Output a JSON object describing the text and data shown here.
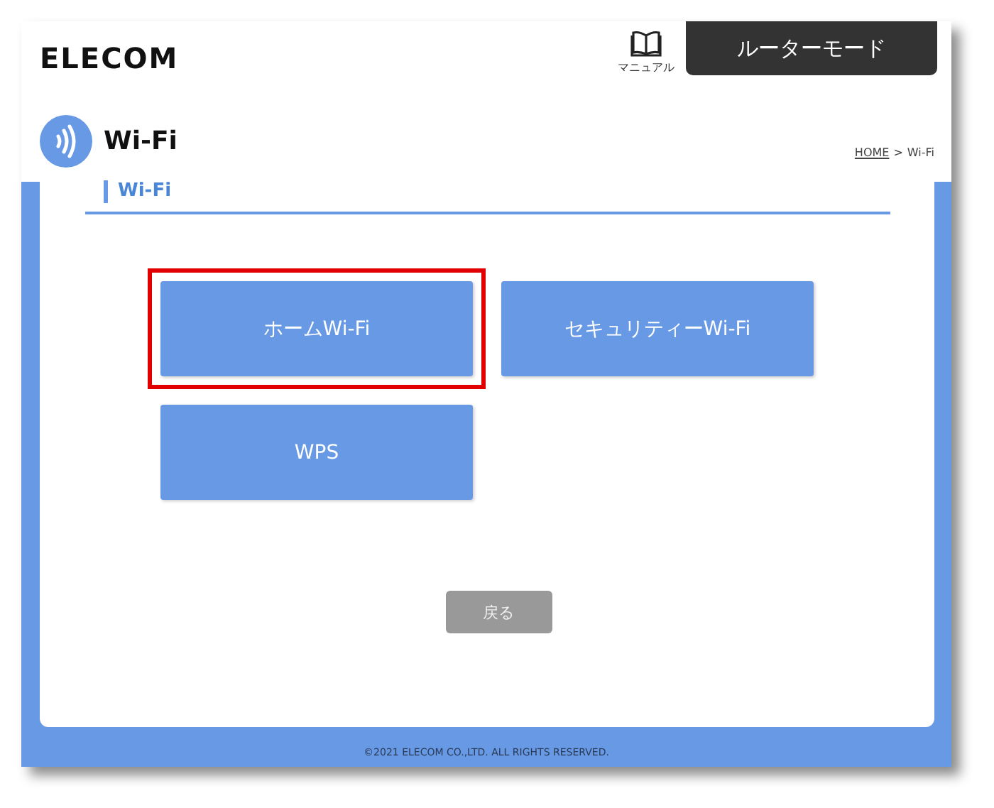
{
  "header": {
    "logo": "ELECOM",
    "manual_label": "マニュアル",
    "mode_button": "ルーターモード"
  },
  "page_title": "Wi-Fi",
  "breadcrumb": [
    {
      "label": "HOME",
      "kind": "link"
    },
    {
      "label": ">",
      "kind": "separator"
    },
    {
      "label": "Wi-Fi",
      "kind": "current"
    }
  ],
  "section_title": "Wi-Fi",
  "menu_buttons": [
    {
      "label": "ホームWi-Fi",
      "highlighted": true
    },
    {
      "label": "セキュリティーWi-Fi",
      "highlighted": false
    },
    {
      "label": "WPS",
      "highlighted": false
    }
  ],
  "back_button": "戻る",
  "footer": "©2021 ELECOM CO.,LTD. ALL RIGHTS RESERVED."
}
